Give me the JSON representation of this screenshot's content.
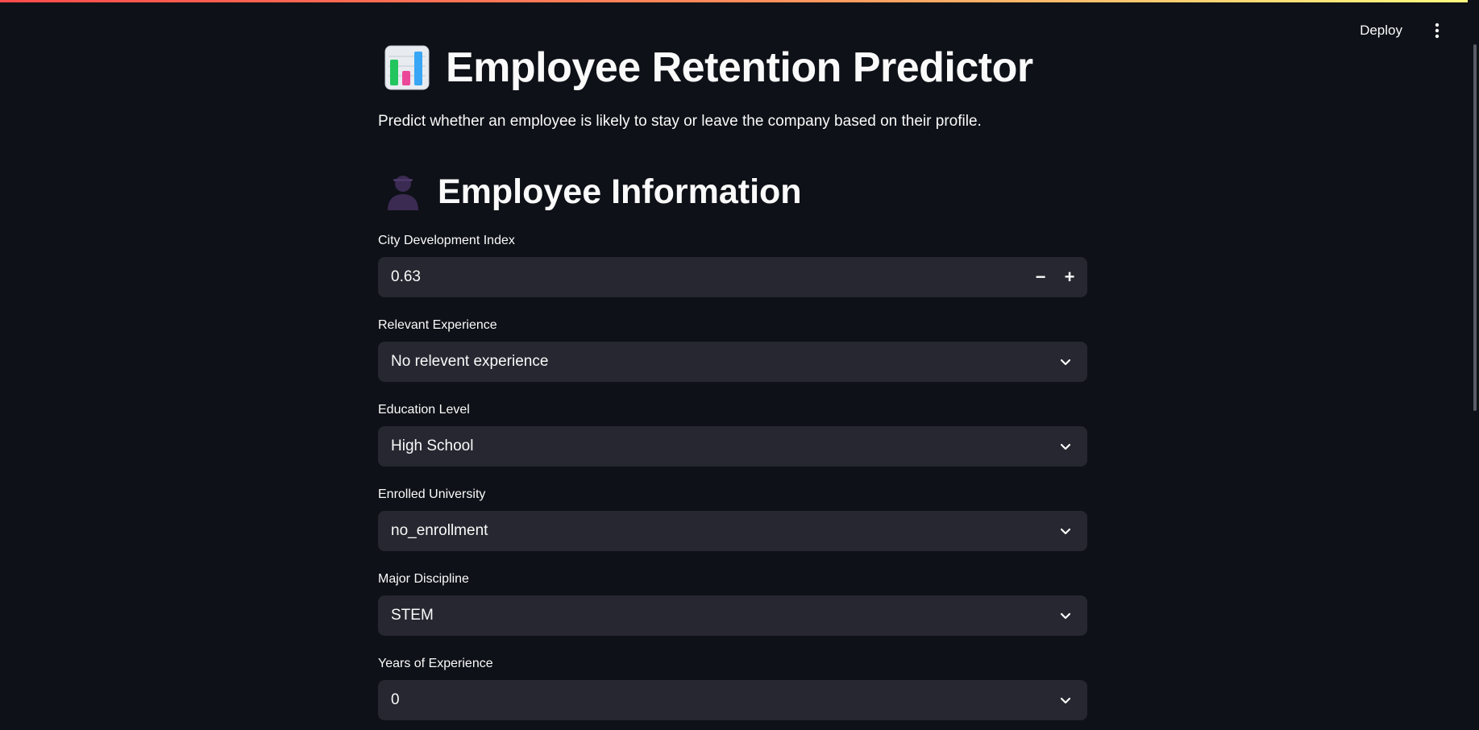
{
  "header": {
    "deploy_label": "Deploy",
    "menu_icon": "vertical-ellipsis-icon"
  },
  "app": {
    "title_icon": "bar-chart-icon",
    "title": "Employee Retention Predictor",
    "subtitle": "Predict whether an employee is likely to stay or leave the company based on their profile."
  },
  "section": {
    "icon": "person-silhouette-icon",
    "title": "Employee Information"
  },
  "fields": {
    "city_dev_index": {
      "label": "City Development Index",
      "value": "0.63",
      "decrement": "−",
      "increment": "+"
    },
    "relevant_experience": {
      "label": "Relevant Experience",
      "value": "No relevent experience"
    },
    "education_level": {
      "label": "Education Level",
      "value": "High School"
    },
    "enrolled_university": {
      "label": "Enrolled University",
      "value": "no_enrollment"
    },
    "major_discipline": {
      "label": "Major Discipline",
      "value": "STEM"
    },
    "years_experience": {
      "label": "Years of Experience",
      "value": "0"
    }
  },
  "colors": {
    "background": "#0e1117",
    "input_bg": "#262730",
    "text": "#fafafa",
    "accent_gradient_start": "#ff4b4b",
    "accent_gradient_end": "#fffd80"
  }
}
